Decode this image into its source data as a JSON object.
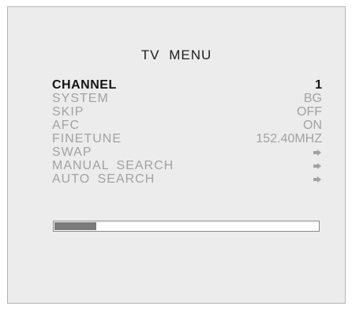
{
  "menu": {
    "title": "TV  MENU",
    "items": [
      {
        "label": "CHANNEL",
        "value": "1",
        "selected": true
      },
      {
        "label": "SYSTEM",
        "value": "BG"
      },
      {
        "label": "SKIP",
        "value": "OFF"
      },
      {
        "label": "AFC",
        "value": "ON"
      },
      {
        "label": "FINETUNE",
        "value": "152.40MHZ"
      },
      {
        "label": "SWAP",
        "icon": "right-arrow-icon"
      },
      {
        "label": "MANUAL  SEARCH",
        "icon": "right-arrow-icon"
      },
      {
        "label": "AUTO  SEARCH",
        "icon": "right-arrow-icon"
      }
    ]
  },
  "progress": {
    "fraction": 0.16
  },
  "colors": {
    "panel_background": "#ececec",
    "selected_text": "#141414",
    "dimmed_text": "#a2a2a2",
    "progress_fill": "#7a7a7a"
  }
}
